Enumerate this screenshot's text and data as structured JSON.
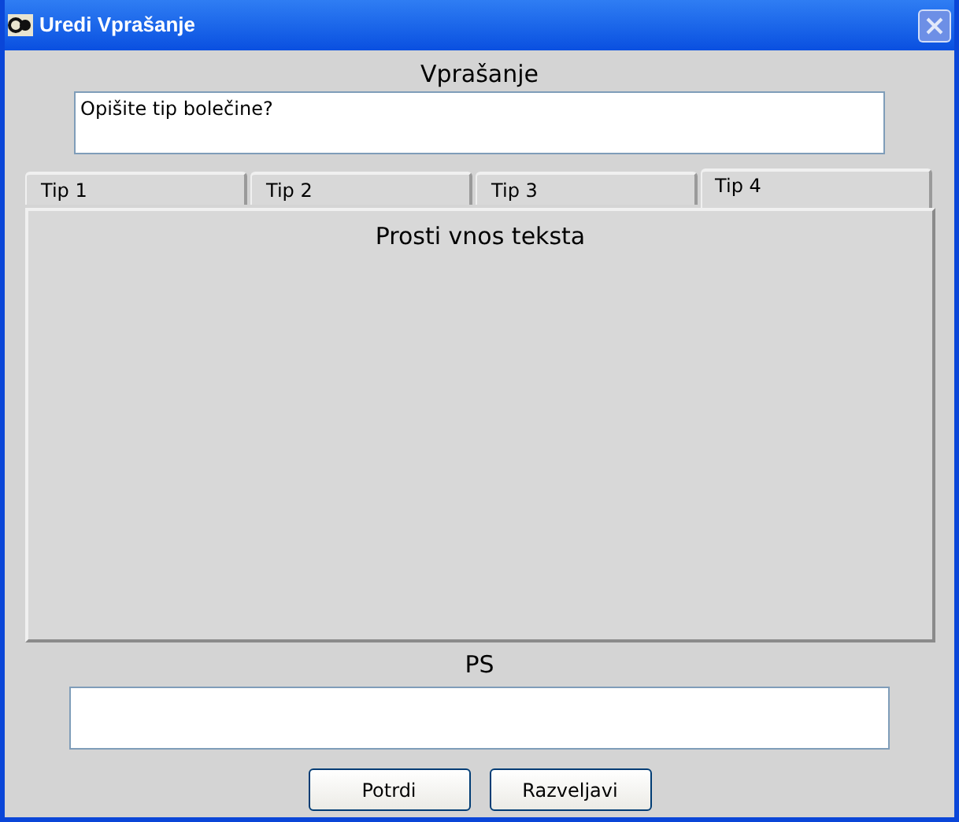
{
  "window": {
    "title": "Uredi Vprašanje"
  },
  "question": {
    "label": "Vprašanje",
    "value": "Opišite tip bolečine?"
  },
  "tabs": [
    {
      "label": "Tip 1",
      "selected": false
    },
    {
      "label": "Tip 2",
      "selected": false
    },
    {
      "label": "Tip 3",
      "selected": false
    },
    {
      "label": "Tip 4",
      "selected": true
    }
  ],
  "panel": {
    "title": "Prosti vnos teksta"
  },
  "ps": {
    "label": "PS"
  },
  "buttons": [
    "Potrdi",
    "Razveljavi"
  ]
}
